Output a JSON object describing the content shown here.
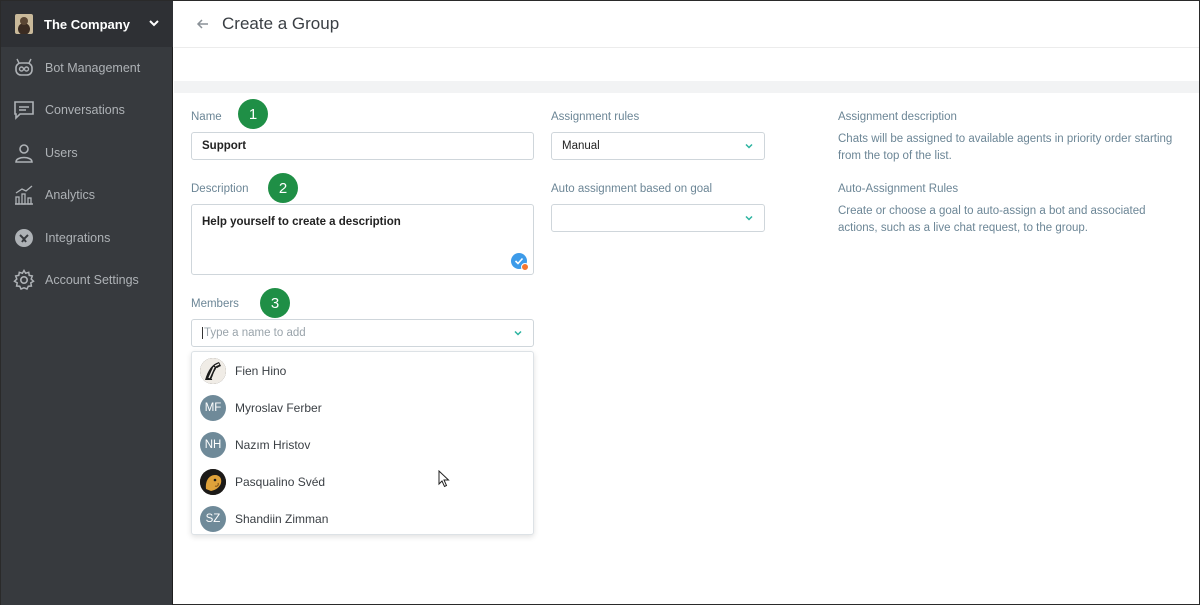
{
  "sidebar": {
    "company_name": "The Company",
    "items": [
      {
        "label": "Bot Management",
        "icon": "bot-icon"
      },
      {
        "label": "Conversations",
        "icon": "chat-icon"
      },
      {
        "label": "Users",
        "icon": "user-icon"
      },
      {
        "label": "Analytics",
        "icon": "bar-chart-icon"
      },
      {
        "label": "Integrations",
        "icon": "integrations-icon"
      },
      {
        "label": "Account Settings",
        "icon": "gear-icon"
      }
    ]
  },
  "header": {
    "title": "Create a Group"
  },
  "form": {
    "name_label": "Name",
    "name_value": "Support",
    "description_label": "Description",
    "description_value": "Help yourself to create a description",
    "members_label": "Members",
    "members_placeholder": "Type a name to add",
    "assignment_rules_label": "Assignment rules",
    "assignment_rules_value": "Manual",
    "auto_assignment_label": "Auto assignment based on goal",
    "auto_assignment_value": ""
  },
  "info": {
    "assignment_description_title": "Assignment description",
    "assignment_description_text": "Chats will be assigned to available agents in priority order starting from the top of the list.",
    "auto_rules_title": "Auto-Assignment Rules",
    "auto_rules_text": "Create or choose a goal to auto-assign a bot and associated actions, such as a live chat request, to the group."
  },
  "badges": [
    "1",
    "2",
    "3"
  ],
  "members": [
    {
      "name": "Fien Hino",
      "initials": "",
      "avatar": "zebra-photo"
    },
    {
      "name": "Myroslav Ferber",
      "initials": "MF",
      "avatar": "initials"
    },
    {
      "name": "Nazım Hristov",
      "initials": "NH",
      "avatar": "initials"
    },
    {
      "name": "Pasqualino Svéd",
      "initials": "",
      "avatar": "dog-photo"
    },
    {
      "name": "Shandiin Zimman",
      "initials": "SZ",
      "avatar": "initials"
    }
  ],
  "colors": {
    "sidebar_bg": "#373a3e",
    "badge_green": "#1f8f46",
    "accent_teal": "#2bb3a0",
    "label_text": "#6c8696"
  }
}
